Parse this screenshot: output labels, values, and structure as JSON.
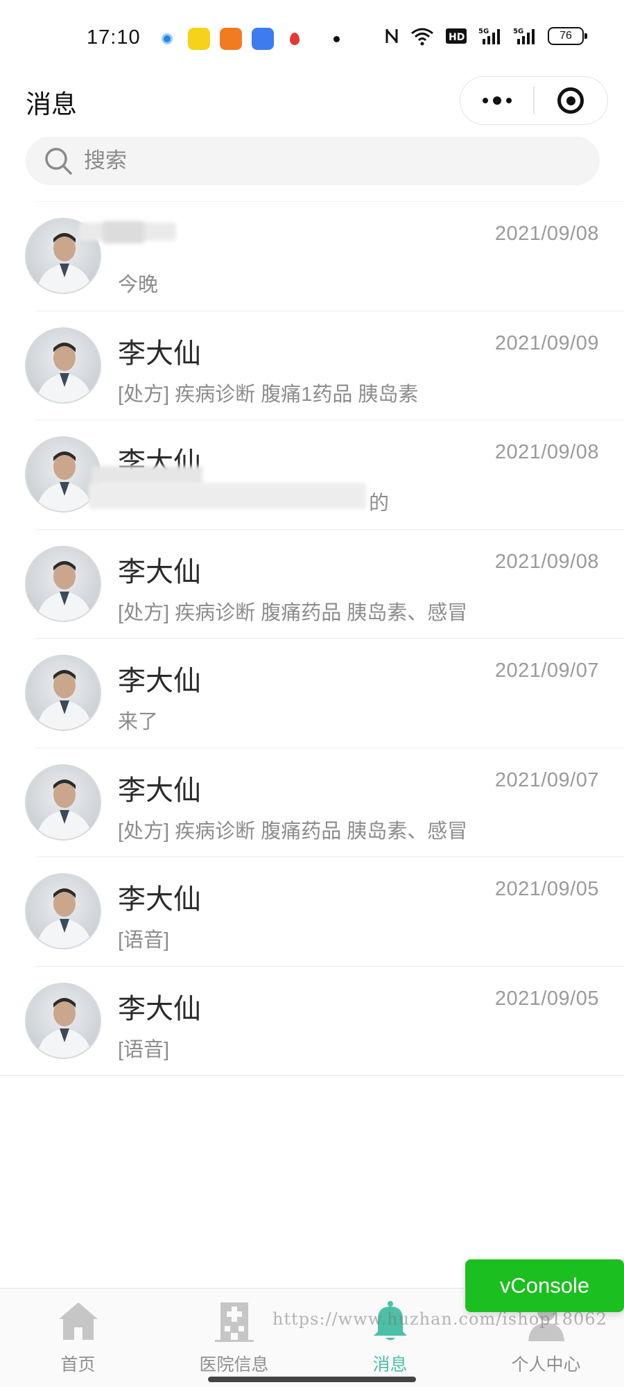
{
  "status_bar": {
    "time": "17:10",
    "battery": "76",
    "icons": [
      "nfc-icon",
      "wifi-icon",
      "hd-icon",
      "signal-5g-icon",
      "signal-5g-icon",
      "battery-icon"
    ]
  },
  "nav": {
    "title": "消息"
  },
  "search": {
    "placeholder": "搜索"
  },
  "chats": [
    {
      "name": "",
      "preview": "今晚",
      "date": "2021/09/08",
      "redacted_name": true
    },
    {
      "name": "李大仙",
      "preview": "[处方] 疾病诊断 腹痛1药品 胰岛素",
      "date": "2021/09/09"
    },
    {
      "name": "李大仙",
      "preview": "的",
      "date": "2021/09/08",
      "redacted_preview": true
    },
    {
      "name": "李大仙",
      "preview": "[处方] 疾病诊断 腹痛药品 胰岛素、感冒",
      "date": "2021/09/08"
    },
    {
      "name": "李大仙",
      "preview": "来了",
      "date": "2021/09/07"
    },
    {
      "name": "李大仙",
      "preview": "[处方] 疾病诊断 腹痛药品 胰岛素、感冒",
      "date": "2021/09/07"
    },
    {
      "name": "李大仙",
      "preview": "[语音]",
      "date": "2021/09/05"
    },
    {
      "name": "李大仙",
      "preview": "[语音]",
      "date": "2021/09/05"
    }
  ],
  "tabs": [
    {
      "label": "首页",
      "icon": "home-icon",
      "active": false
    },
    {
      "label": "医院信息",
      "icon": "hospital-icon",
      "active": false
    },
    {
      "label": "消息",
      "icon": "bell-icon",
      "active": true
    },
    {
      "label": "个人中心",
      "icon": "person-icon",
      "active": false
    }
  ],
  "vconsole": {
    "label": "vConsole"
  },
  "watermark": "https://www.huzhan.com/ishop18062",
  "colors": {
    "accent": "#4cc0a6",
    "vconsole": "#1bbf1f",
    "tab_inactive": "#c6c6c6"
  }
}
